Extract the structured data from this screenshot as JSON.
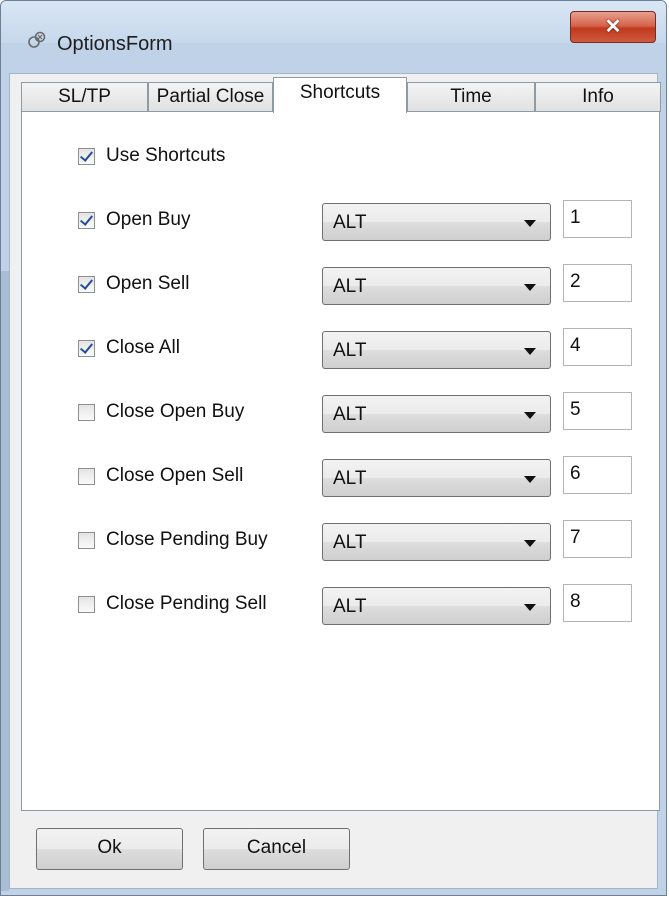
{
  "window": {
    "title": "OptionsForm",
    "close_label": "✕"
  },
  "tabs": [
    {
      "label": "SL/TP",
      "active": false
    },
    {
      "label": "Partial Close",
      "active": false
    },
    {
      "label": "Shortcuts",
      "active": true
    },
    {
      "label": "Time",
      "active": false
    },
    {
      "label": "Info",
      "active": false
    }
  ],
  "use_shortcuts": {
    "label": "Use Shortcuts",
    "checked": true
  },
  "shortcuts": [
    {
      "label": "Open Buy",
      "checked": true,
      "modifier": "ALT",
      "key": "1"
    },
    {
      "label": "Open Sell",
      "checked": true,
      "modifier": "ALT",
      "key": "2"
    },
    {
      "label": "Close All",
      "checked": true,
      "modifier": "ALT",
      "key": "4"
    },
    {
      "label": "Close Open Buy",
      "checked": false,
      "modifier": "ALT",
      "key": "5"
    },
    {
      "label": "Close Open Sell",
      "checked": false,
      "modifier": "ALT",
      "key": "6"
    },
    {
      "label": "Close Pending Buy",
      "checked": false,
      "modifier": "ALT",
      "key": "7"
    },
    {
      "label": "Close Pending Sell",
      "checked": false,
      "modifier": "ALT",
      "key": "8"
    }
  ],
  "buttons": {
    "ok_label": "Ok",
    "cancel_label": "Cancel"
  }
}
